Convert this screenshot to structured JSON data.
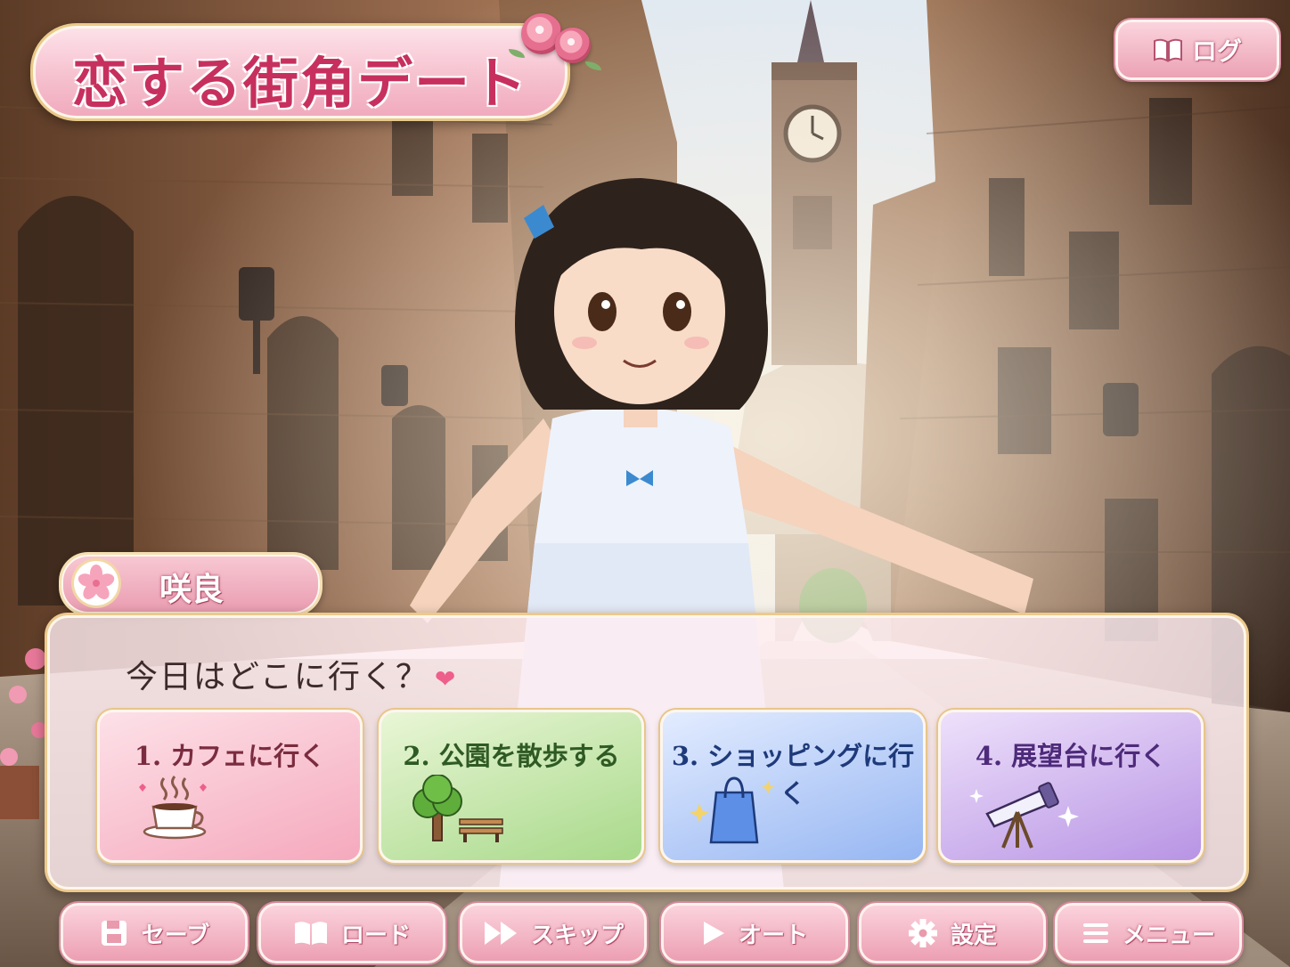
{
  "game": {
    "title": "恋する街角デート"
  },
  "header": {
    "log_label": "ログ"
  },
  "dialog": {
    "speaker": "咲良",
    "line": "今日はどこに行く？",
    "heart_icon": "heart-icon"
  },
  "choices": [
    {
      "label": "1. カフェに行く",
      "icon": "coffee-cup-icon",
      "color": "#f5a9bd"
    },
    {
      "label": "2. 公園を散歩する",
      "icon": "tree-bench-icon",
      "color": "#a8d98a"
    },
    {
      "label": "3. ショッピングに行く",
      "icon": "shopping-bag-icon",
      "color": "#96b6f2"
    },
    {
      "label": "4. 展望台に行く",
      "icon": "telescope-icon",
      "color": "#b894e4"
    }
  ],
  "menu": {
    "save": "セーブ",
    "load": "ロード",
    "skip": "スキップ",
    "auto": "オート",
    "settings": "設定",
    "menu": "メニュー"
  },
  "colors": {
    "accent_pink": "#ec9fb2",
    "title_pink": "#c7305e",
    "gold_trim": "#ecc98d"
  }
}
